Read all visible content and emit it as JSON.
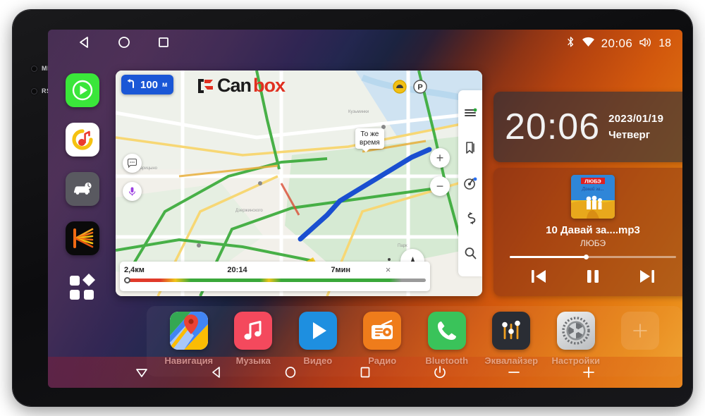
{
  "device": {
    "bezel_labels": [
      {
        "text": "MIC"
      },
      {
        "text": "RST"
      }
    ]
  },
  "statusbar": {
    "back_icon": "back-triangle-icon",
    "home_icon": "home-circle-icon",
    "recents_icon": "recents-square-icon",
    "bluetooth_icon": "bluetooth-icon",
    "wifi_icon": "wifi-icon",
    "time": "20:06",
    "volume_icon": "volume-icon",
    "volume_level": "18"
  },
  "sidebar": {
    "items": [
      {
        "name": "spotify",
        "icon": "play-circle-icon"
      },
      {
        "name": "yandex-music",
        "icon": "yandex-music-icon"
      },
      {
        "name": "car-info",
        "icon": "car-icon"
      },
      {
        "name": "kaspersky",
        "icon": "burst-icon"
      },
      {
        "name": "all-apps",
        "icon": "apps-grid-icon"
      }
    ]
  },
  "map": {
    "nav_banner": {
      "arrow_icon": "turn-left-icon",
      "distance": "100",
      "unit": "м"
    },
    "brand": {
      "mark": "canbox-mark-icon",
      "part1": "Can",
      "part2": "box"
    },
    "tooltip": "То же\nвремя",
    "tooltip_line1": "То же",
    "tooltip_line2": "время",
    "buttons": {
      "chat_icon": "chat-bubble-icon",
      "mic_icon": "microphone-icon",
      "zoom_in": "+",
      "zoom_out": "−",
      "locate_icon": "navigation-arrow-icon",
      "person_icon": "person-pin-icon"
    },
    "rail": [
      {
        "name": "layers",
        "icon": "layers-menu-icon"
      },
      {
        "name": "bookmarks",
        "icon": "bookmark-icon"
      },
      {
        "name": "compass",
        "icon": "compass-icon"
      },
      {
        "name": "route-swap",
        "icon": "route-swap-icon"
      },
      {
        "name": "search",
        "icon": "search-icon"
      }
    ],
    "route": {
      "distance": "2,4км",
      "arrival": "20:14",
      "duration": "7мин",
      "close_icon": "×"
    },
    "poi": {
      "parking_icon": "parking-p-icon",
      "yellow_icon": "yellow-marker-icon"
    }
  },
  "clock_widget": {
    "time": "20:06",
    "date": "2023/01/19",
    "weekday": "Четверг"
  },
  "music_widget": {
    "album_art_icon": "album-art-lyube",
    "album_title": "ЛЮБЭ",
    "track": "10 Давай за....mp3",
    "artist": "ЛЮБЭ",
    "progress_percent": 46,
    "prev_icon": "skip-previous-icon",
    "play_pause_icon": "pause-icon",
    "next_icon": "skip-next-icon"
  },
  "dock": {
    "items": [
      {
        "label": "Навигация",
        "icon": "google-maps-icon",
        "cls": "dk-maps"
      },
      {
        "label": "Музыка",
        "icon": "music-note-icon",
        "cls": "dk-music"
      },
      {
        "label": "Видео",
        "icon": "play-triangle-icon",
        "cls": "dk-video"
      },
      {
        "label": "Радио",
        "icon": "radio-icon",
        "cls": "dk-radio"
      },
      {
        "label": "Bluetooth",
        "icon": "phone-icon",
        "cls": "dk-bt"
      },
      {
        "label": "Эквалайзер",
        "icon": "equalizer-icon",
        "cls": "dk-eq"
      },
      {
        "label": "Настройки",
        "icon": "gear-icon",
        "cls": "dk-set"
      },
      {
        "label": "",
        "icon": "plus-icon",
        "cls": "dk-add"
      }
    ]
  },
  "sysbar": {
    "items": [
      {
        "name": "collapse",
        "icon": "triangle-down-icon"
      },
      {
        "name": "back",
        "icon": "back-triangle-icon"
      },
      {
        "name": "home",
        "icon": "home-circle-icon"
      },
      {
        "name": "recents",
        "icon": "recents-square-icon"
      },
      {
        "name": "power",
        "icon": "power-icon"
      },
      {
        "name": "volume-down",
        "icon": "minus-icon"
      },
      {
        "name": "volume-up",
        "icon": "plus-icon"
      }
    ]
  },
  "colors": {
    "accent_orange": "#e0720f",
    "accent_purple": "#3a1f47",
    "brand_red": "#e03020",
    "nav_blue": "#1a57d6"
  }
}
